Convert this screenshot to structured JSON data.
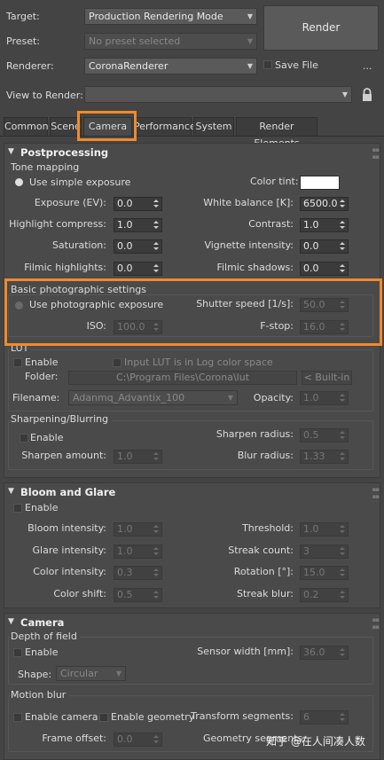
{
  "header": {
    "target_label": "Target:",
    "target_value": "Production Rendering Mode",
    "preset_label": "Preset:",
    "preset_value": "No preset selected",
    "renderer_label": "Renderer:",
    "renderer_value": "CoronaRenderer",
    "save_file_label": "Save File",
    "more_label": "...",
    "view_label": "View to Render:",
    "view_value": "",
    "render_button": "Render"
  },
  "tabs": [
    "Common",
    "Scene",
    "Camera",
    "Performance",
    "System",
    "Render Elements"
  ],
  "active_tab": "Camera",
  "postprocessing": {
    "title": "Postprocessing",
    "tone_mapping": {
      "title": "Tone mapping",
      "use_simple_exposure": "Use simple exposure",
      "color_tint_label": "Color tint:",
      "exposure_label": "Exposure (EV):",
      "exposure_value": "0.0",
      "white_balance_label": "White balance [K]:",
      "white_balance_value": "6500.0",
      "highlight_label": "Highlight compress:",
      "highlight_value": "1.0",
      "contrast_label": "Contrast:",
      "contrast_value": "1.0",
      "saturation_label": "Saturation:",
      "saturation_value": "0.0",
      "vignette_label": "Vignette intensity:",
      "vignette_value": "0.0",
      "filmic_highlights_label": "Filmic highlights:",
      "filmic_highlights_value": "0.0",
      "filmic_shadows_label": "Filmic shadows:",
      "filmic_shadows_value": "0.0"
    },
    "photographic": {
      "title": "Basic photographic settings",
      "use_photographic_exposure": "Use photographic exposure",
      "shutter_label": "Shutter speed [1/s]:",
      "shutter_value": "50.0",
      "iso_label": "ISO:",
      "iso_value": "100.0",
      "fstop_label": "F-stop:",
      "fstop_value": "16.0"
    },
    "lut": {
      "title": "LUT",
      "enable_label": "Enable",
      "log_label": "Input LUT is in Log color space",
      "folder_label": "Folder:",
      "folder_value": "C:\\Program Files\\Corona\\lut",
      "builtin_label": "< Built-in",
      "filename_label": "Filename:",
      "filename_value": "Adanmq_Advantix_100",
      "opacity_label": "Opacity:",
      "opacity_value": "1.0"
    },
    "sharpen": {
      "title": "Sharpening/Blurring",
      "enable_label": "Enable",
      "sharpen_radius_label": "Sharpen radius:",
      "sharpen_radius_value": "0.5",
      "sharpen_amount_label": "Sharpen amount:",
      "sharpen_amount_value": "1.0",
      "blur_radius_label": "Blur radius:",
      "blur_radius_value": "1.33"
    }
  },
  "bloom": {
    "title": "Bloom and Glare",
    "enable_label": "Enable",
    "bloom_intensity_label": "Bloom intensity:",
    "bloom_intensity_value": "1.0",
    "threshold_label": "Threshold:",
    "threshold_value": "1.0",
    "glare_intensity_label": "Glare intensity:",
    "glare_intensity_value": "1.0",
    "streak_count_label": "Streak count:",
    "streak_count_value": "3",
    "color_intensity_label": "Color intensity:",
    "color_intensity_value": "0.3",
    "rotation_label": "Rotation [°]:",
    "rotation_value": "15.0",
    "color_shift_label": "Color shift:",
    "color_shift_value": "0.5",
    "streak_blur_label": "Streak blur:",
    "streak_blur_value": "0.2"
  },
  "camera": {
    "title": "Camera",
    "dof_title": "Depth of field",
    "dof_enable_label": "Enable",
    "sensor_width_label": "Sensor width [mm]:",
    "sensor_width_value": "36.0",
    "shape_label": "Shape:",
    "shape_value": "Circular",
    "motion_blur_title": "Motion blur",
    "enable_camera_label": "Enable camera",
    "enable_geometry_label": "Enable geometry",
    "transform_segments_label": "Transform segments:",
    "transform_segments_value": "6",
    "frame_offset_label": "Frame offset:",
    "frame_offset_value": "0.0",
    "geometry_segments_label": "Geometry segments:"
  },
  "watermark": "知乎 @在人间凑人数",
  "colors": {
    "highlight": "#f08a2c",
    "panel": "#444444",
    "color_tint": "#ffffff"
  }
}
